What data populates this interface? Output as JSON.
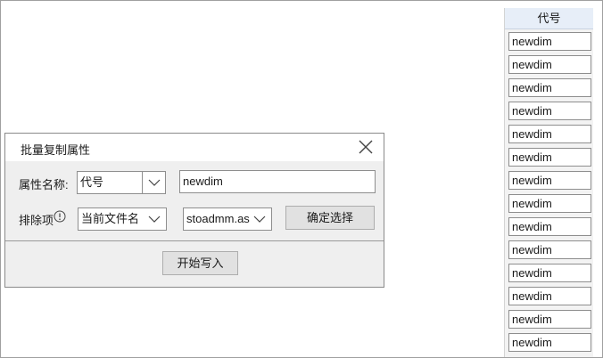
{
  "side_panel": {
    "header": "代号",
    "cells": [
      "newdim",
      "newdim",
      "newdim",
      "newdim",
      "newdim",
      "newdim",
      "newdim",
      "newdim",
      "newdim",
      "newdim",
      "newdim",
      "newdim",
      "newdim",
      "newdim"
    ]
  },
  "dialog": {
    "title": "批量复制属性",
    "property_name_label": "属性名称:",
    "property_select_value": "代号",
    "property_value": "newdim",
    "exclude_label": "排除项",
    "exclude_select_value": "当前文件名",
    "file_select_value": "stoadmm.as",
    "confirm_button": "确定选择",
    "start_button": "开始写入"
  }
}
